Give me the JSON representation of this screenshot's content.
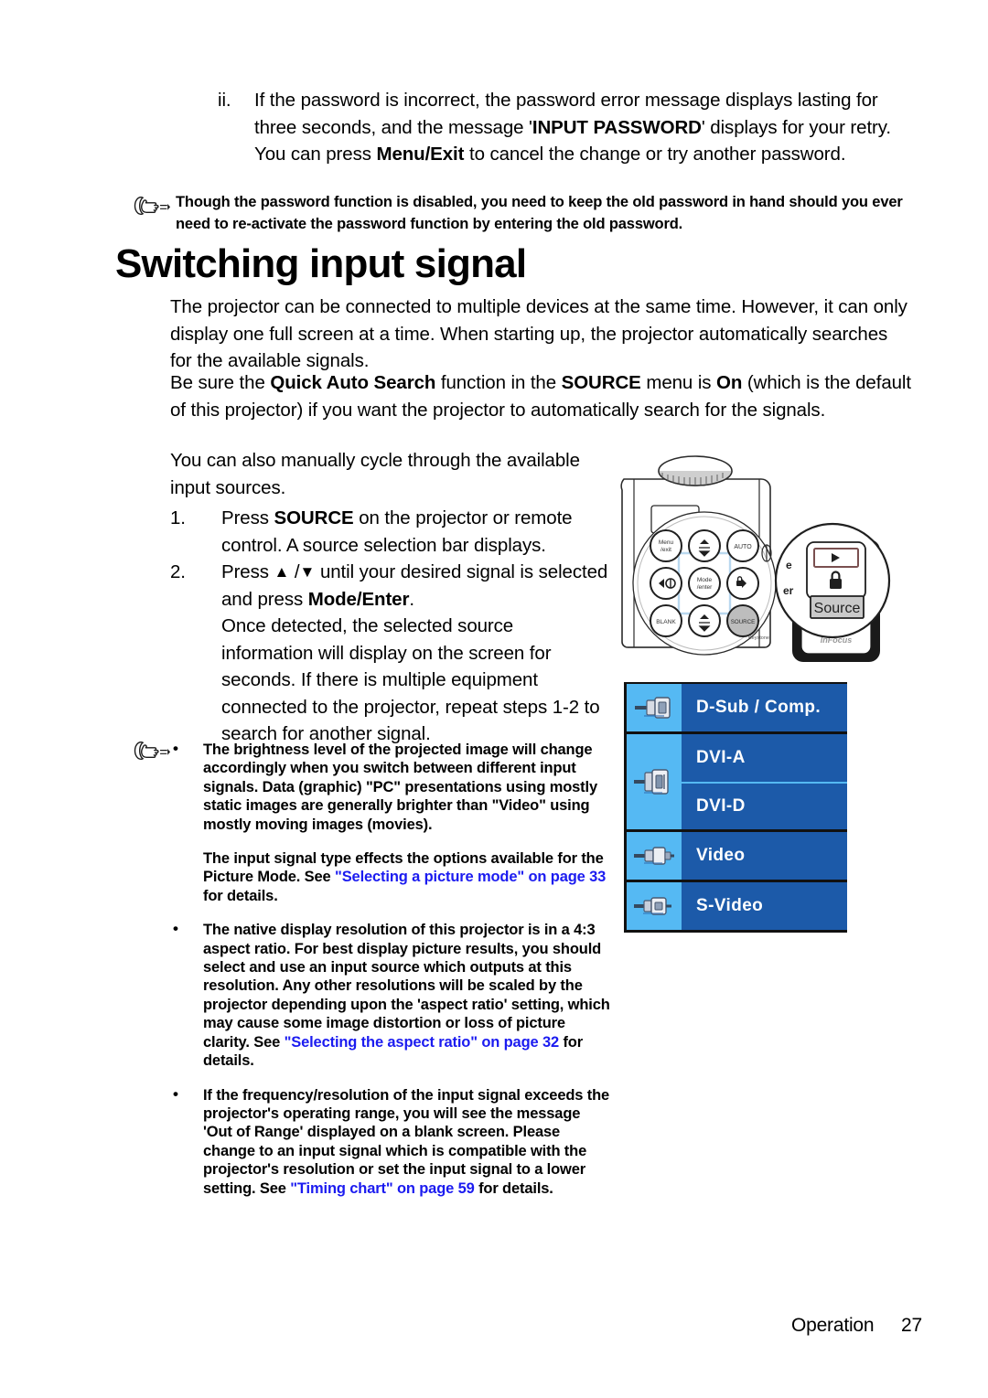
{
  "roman_item": {
    "marker": "ii.",
    "text_parts": [
      {
        "t": "If the password is incorrect, the password error message displays lasting for three seconds, and the message '",
        "b": false
      },
      {
        "t": "INPUT PASSWORD",
        "b": true
      },
      {
        "t": "' displays for your retry. You can press ",
        "b": false
      },
      {
        "t": "Menu/Exit",
        "b": true
      },
      {
        "t": " to cancel the change or try another password.",
        "b": false
      }
    ]
  },
  "note_top": {
    "icon": "pointing-hand-icon",
    "text": "Though the password function is disabled, you need to keep the old password in hand should you ever need to re-activate the password function by entering the old password."
  },
  "section": {
    "title": "Switching input signal",
    "para_1": "The projector can be connected to multiple devices at the same time. However, it can only display one full screen at a time. When starting up, the projector automatically searches for the available signals.",
    "para_2_parts": [
      {
        "t": "Be sure the ",
        "b": false
      },
      {
        "t": "Quick Auto Search",
        "b": true
      },
      {
        "t": " function in the ",
        "b": false
      },
      {
        "t": "SOURCE",
        "b": true
      },
      {
        "t": " menu is ",
        "b": false
      },
      {
        "t": "On",
        "b": true
      },
      {
        "t": " (which is the default of this projector) if you want the projector to automatically search for the signals.",
        "b": false
      }
    ],
    "para_3": "You can also manually cycle through the available input sources."
  },
  "steps": [
    {
      "num": "1.",
      "parts": [
        {
          "t": "Press ",
          "b": false
        },
        {
          "t": "SOURCE",
          "b": true
        },
        {
          "t": " on the projector or remote control. A source selection bar displays.",
          "b": false
        }
      ]
    },
    {
      "num": "2.",
      "parts": [
        {
          "t": "Press ",
          "b": false
        },
        {
          "t": "▲",
          "b": true
        },
        {
          "t": " /",
          "b": false
        },
        {
          "t": "▼",
          "b": true
        },
        {
          "t": " until your desired signal is selected and press ",
          "b": false
        },
        {
          "t": "Mode/Enter",
          "b": true
        },
        {
          "t": ".",
          "b": false
        }
      ],
      "sub": "Once detected, the selected source information will display on the screen for seconds. If there is multiple equipment connected to the projector, repeat steps 1-2 to search for another signal."
    }
  ],
  "notes": [
    {
      "bullet": "•",
      "parts": [
        {
          "t": "The brightness level of the projected image will change accordingly when you switch between different input signals. Data (graphic) \"PC\" presentations using mostly static images are generally brighter than \"Video\" using mostly moving images (movies).",
          "link": false
        }
      ]
    },
    {
      "bullet": "",
      "parts": [
        {
          "t": "The input signal type effects the options available for the Picture Mode. See ",
          "link": false
        },
        {
          "t": "\"Selecting a picture mode\" on page 33",
          "link": true
        },
        {
          "t": " for details.",
          "link": false
        }
      ]
    },
    {
      "bullet": "•",
      "parts": [
        {
          "t": "The native display resolution of this projector is in a 4:3 aspect ratio. For best display picture results, you should select and use an input source which outputs at this resolution. Any other resolutions will be scaled by the projector depending upon the 'aspect ratio' setting, which may cause some image distortion or loss of picture clarity. See ",
          "link": false
        },
        {
          "t": "\"Selecting the aspect ratio\" on page 32",
          "link": true
        },
        {
          "t": " for details.",
          "link": false
        }
      ]
    },
    {
      "bullet": "•",
      "parts": [
        {
          "t": "If the frequency/resolution of the input signal exceeds the projector's operating range, you will see the message 'Out of Range' displayed on a blank screen. Please change to an input signal which is compatible with the projector's resolution or set the input signal to a lower setting. See ",
          "link": false
        },
        {
          "t": "\"Timing chart\" on page 59",
          "link": true
        },
        {
          "t": " for details.",
          "link": false
        }
      ]
    }
  ],
  "source_bar": {
    "colors": {
      "icon_cell": "#55b9f3",
      "label_cell": "#1c5aa9",
      "label_text": "#ffffff",
      "divider": "#111111"
    },
    "groups": [
      {
        "icon": "vga-dsub-connector-icon",
        "rows": [
          {
            "label": "D-Sub / Comp."
          }
        ]
      },
      {
        "icon": "dvi-connector-icon",
        "rows": [
          {
            "label": "DVI-A"
          },
          {
            "label": "DVI-D"
          }
        ]
      },
      {
        "icon": "composite-video-connector-icon",
        "rows": [
          {
            "label": "Video"
          }
        ]
      },
      {
        "icon": "s-video-connector-icon",
        "rows": [
          {
            "label": "S-Video"
          }
        ]
      }
    ]
  },
  "artwork": {
    "projector": {
      "keys": [
        {
          "name": "menu-exit-key",
          "label": "Menu\nExit"
        },
        {
          "name": "up-arrow-keystone-key",
          "label": "▲"
        },
        {
          "name": "auto-key",
          "label": "AUTO"
        },
        {
          "name": "left-volume-key",
          "label": "◄"
        },
        {
          "name": "mode-enter-key",
          "label": "Mode\nEnter"
        },
        {
          "name": "right-lock-key",
          "label": "►"
        },
        {
          "name": "blank-key",
          "label": "BLANK"
        },
        {
          "name": "down-arrow-keystone-key",
          "label": "▼"
        },
        {
          "name": "source-key",
          "label": "SOURCE"
        }
      ]
    },
    "remote": {
      "play_key": "▶",
      "lock_icon": "padlock-icon",
      "source_key": "Source",
      "brand": "InFocus"
    }
  },
  "footer": {
    "label": "Operation",
    "page": "27"
  }
}
